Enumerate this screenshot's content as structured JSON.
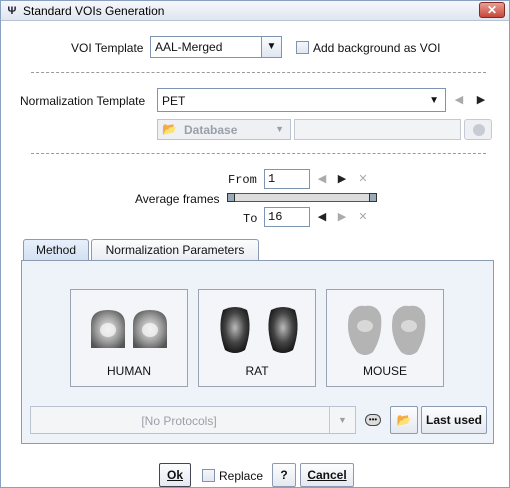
{
  "window": {
    "title": "Standard VOIs Generation",
    "close_glyph": "✕",
    "app_icon": "pmod-icon"
  },
  "voi_template": {
    "label": "VOI Template",
    "value": "AAL-Merged",
    "background_label": "Add background as VOI",
    "background_checked": false
  },
  "normalization": {
    "label": "Normalization Template",
    "value": "PET",
    "source_value": "Database"
  },
  "frames": {
    "from_label": "From",
    "from_value": "1",
    "average_label": "Average frames",
    "to_label": "To",
    "to_value": "16"
  },
  "tabs": [
    {
      "label": "Method",
      "active": true
    },
    {
      "label": "Normalization Parameters",
      "active": false
    }
  ],
  "methods": [
    {
      "label": "HUMAN"
    },
    {
      "label": "RAT"
    },
    {
      "label": "MOUSE"
    }
  ],
  "protocols": {
    "value": "[No Protocols]",
    "last_used_label": "Last used"
  },
  "footer": {
    "ok_label": "Ok",
    "replace_label": "Replace",
    "replace_checked": false,
    "help_label": "?",
    "cancel_label": "Cancel"
  }
}
